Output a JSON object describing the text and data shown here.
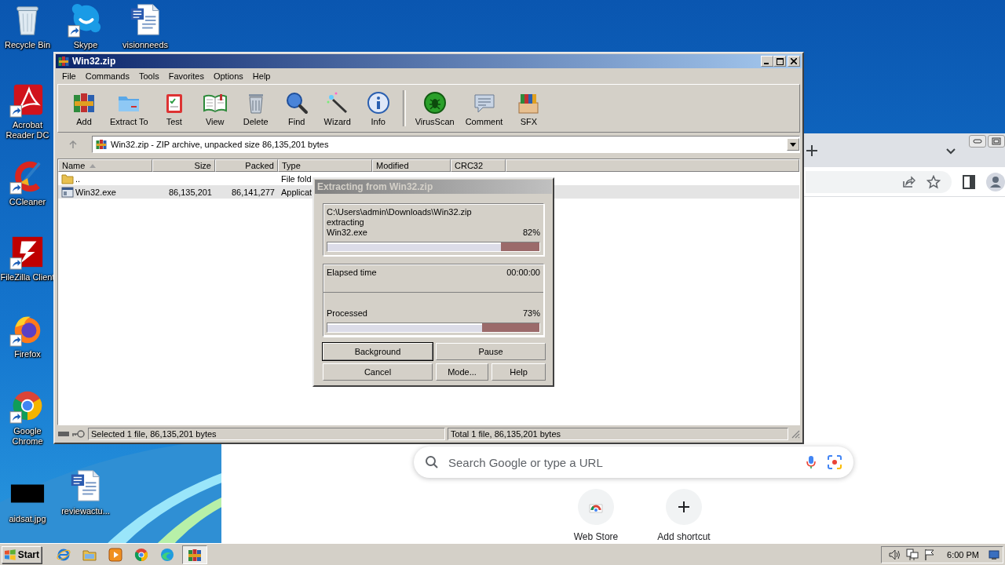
{
  "desktop": {
    "icons": [
      {
        "label": "Recycle Bin",
        "shortcut": false
      },
      {
        "label": "Skype",
        "shortcut": true
      },
      {
        "label": "visionneeds",
        "shortcut": false
      },
      {
        "label": "Acrobat Reader DC",
        "shortcut": true
      },
      {
        "label": "CCleaner",
        "shortcut": true
      },
      {
        "label": "FileZilla Client",
        "shortcut": true
      },
      {
        "label": "Firefox",
        "shortcut": true
      },
      {
        "label": "Google Chrome",
        "shortcut": true
      },
      {
        "label": "aidsat.jpg",
        "shortcut": false
      },
      {
        "label": "reviewactu...",
        "shortcut": false
      }
    ]
  },
  "browser": {
    "search": {
      "placeholder": "Search Google or type a URL"
    },
    "shortcuts": [
      {
        "label": "Web Store"
      },
      {
        "label": "Add shortcut"
      }
    ]
  },
  "archiver": {
    "title": "Win32.zip",
    "menu": [
      "File",
      "Commands",
      "Tools",
      "Favorites",
      "Options",
      "Help"
    ],
    "toolbar": [
      {
        "label": "Add"
      },
      {
        "label": "Extract To"
      },
      {
        "label": "Test"
      },
      {
        "label": "View"
      },
      {
        "label": "Delete"
      },
      {
        "label": "Find"
      },
      {
        "label": "Wizard"
      },
      {
        "label": "Info"
      },
      {
        "label": "VirusScan"
      },
      {
        "label": "Comment"
      },
      {
        "label": "SFX"
      }
    ],
    "address": "Win32.zip - ZIP archive, unpacked size 86,135,201 bytes",
    "columns": [
      {
        "label": "Name",
        "sorted": true
      },
      {
        "label": "Size",
        "sorted": false
      },
      {
        "label": "Packed",
        "sorted": false
      },
      {
        "label": "Type",
        "sorted": false
      },
      {
        "label": "Modified",
        "sorted": false
      },
      {
        "label": "CRC32",
        "sorted": false
      }
    ],
    "rows": [
      {
        "kind": "folder",
        "name": "..",
        "type": "File fold",
        "selected": false
      },
      {
        "kind": "file",
        "name": "Win32.exe",
        "size": "86,135,201",
        "packed": "86,141,277",
        "type": "Applicat",
        "selected": true
      }
    ],
    "status": {
      "selected": "Selected 1 file, 86,135,201 bytes",
      "total": "Total 1 file, 86,135,201 bytes"
    }
  },
  "extract_dialog": {
    "title": "Extracting from Win32.zip",
    "archive_path": "C:\\Users\\admin\\Downloads\\Win32.zip",
    "action": "extracting",
    "file": "Win32.exe",
    "file_percent": "82%",
    "file_bar": {
      "level": 0.82
    },
    "elapsed_label": "Elapsed time",
    "elapsed": "00:00:00",
    "processed_label": "Processed",
    "processed_percent": "73%",
    "processed_bar": {
      "level": 0.73
    },
    "buttons": [
      {
        "label": "Background",
        "default": true
      },
      {
        "label": "Pause",
        "default": false
      },
      {
        "label": "Cancel",
        "default": false
      },
      {
        "label": "Mode...",
        "default": false
      },
      {
        "label": "Help",
        "default": false
      }
    ]
  },
  "taskbar": {
    "start": "Start",
    "apps": [
      {
        "active": false
      },
      {
        "active": false
      },
      {
        "active": false
      },
      {
        "active": false
      },
      {
        "active": false
      },
      {
        "active": true
      }
    ],
    "clock": "6:00 PM"
  }
}
